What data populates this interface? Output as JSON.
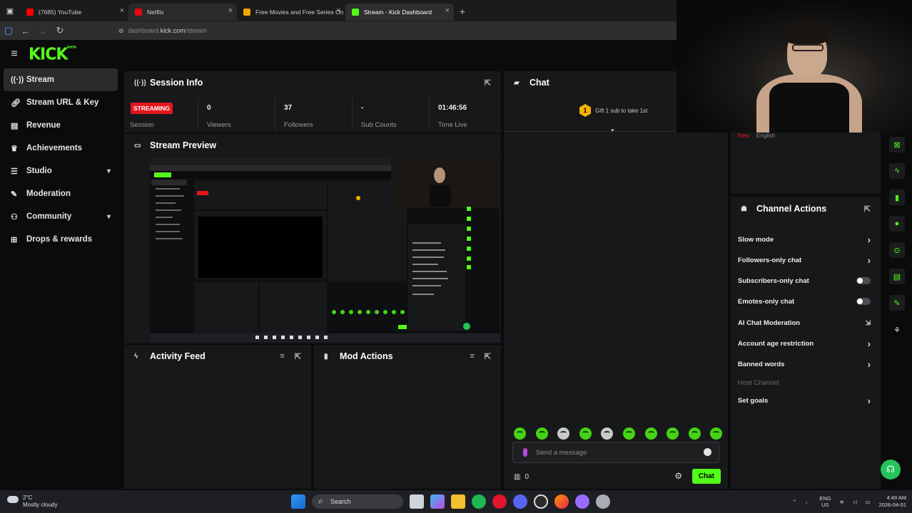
{
  "browser": {
    "tabs": [
      {
        "label": "(7685) YouTube",
        "color": "#ff0000"
      },
      {
        "label": "Netflix",
        "color": "#e50914"
      },
      {
        "label": "Free Movies and Free Series On",
        "color": "#f0a800"
      },
      {
        "label": "Stream - Kick Dashboard",
        "color": "#53fc18"
      }
    ],
    "url_prefix": "dashboard.",
    "url_domain": "kick.com",
    "url_path": "/stream"
  },
  "kick": {
    "logo": "KICK",
    "logo_suffix": "beta",
    "accent": "#53fc18"
  },
  "sidebar": {
    "items": [
      {
        "label": "Stream",
        "icon": "broadcast-icon"
      },
      {
        "label": "Stream URL & Key",
        "icon": "link-icon"
      },
      {
        "label": "Revenue",
        "icon": "chart-icon"
      },
      {
        "label": "Achievements",
        "icon": "trophy-icon"
      },
      {
        "label": "Studio",
        "icon": "sliders-icon"
      },
      {
        "label": "Moderation",
        "icon": "wrench-icon"
      },
      {
        "label": "Community",
        "icon": "users-icon"
      },
      {
        "label": "Drops & rewards",
        "icon": "gift-icon"
      }
    ]
  },
  "session": {
    "title": "Session Info",
    "status": "STREAMING",
    "status_label": "Session",
    "stats": [
      {
        "value": "0",
        "label": "Viewers"
      },
      {
        "value": "37",
        "label": "Followers"
      },
      {
        "value": "-",
        "label": "Sub Counts"
      },
      {
        "value": "01:46:56",
        "label": "Time Live"
      }
    ]
  },
  "preview": {
    "title": "Stream Preview"
  },
  "activity": {
    "title": "Activity Feed"
  },
  "mod_actions": {
    "title": "Mod Actions"
  },
  "chat": {
    "title": "Chat",
    "gift_rank": "1",
    "gift_text": "Gift 1 sub to take 1st",
    "placeholder": "Send a message",
    "count": "0",
    "send_label": "Chat",
    "language_tags": [
      "New",
      "English"
    ]
  },
  "channel_actions": {
    "title": "Channel Actions",
    "items": [
      {
        "label": "Slow mode",
        "control": "arrow"
      },
      {
        "label": "Followers-only chat",
        "control": "arrow"
      },
      {
        "label": "Subscribers-only chat",
        "control": "toggle"
      },
      {
        "label": "Emotes-only chat",
        "control": "toggle"
      },
      {
        "label": "AI Chat Moderation",
        "control": "link"
      },
      {
        "label": "Account age restriction",
        "control": "arrow"
      },
      {
        "label": "Banned words",
        "control": "arrow"
      },
      {
        "label": "Host Channel",
        "control": "none"
      },
      {
        "label": "Set goals",
        "control": "arrow"
      }
    ]
  },
  "taskbar": {
    "temp": "2°C",
    "weather": "Mostly cloudy",
    "search": "Search",
    "lang": "ENG",
    "region": "US",
    "time": "4:49 AM",
    "date": "2026-04-01"
  }
}
